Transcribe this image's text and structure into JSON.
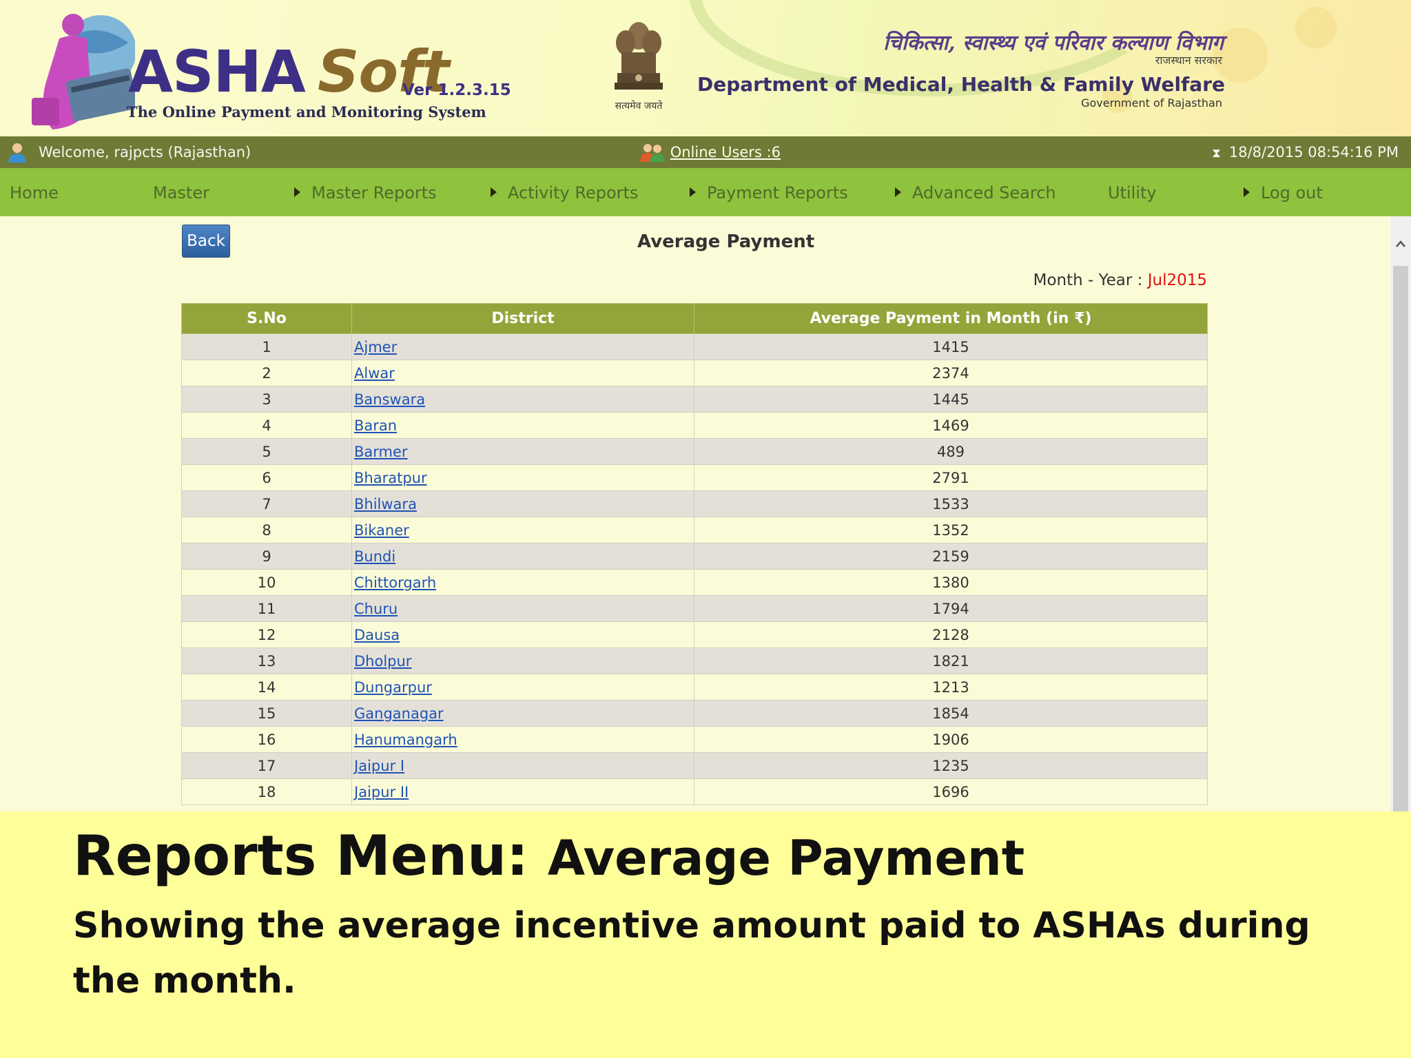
{
  "header": {
    "app_name_part1": "ASHA",
    "app_name_part2": "Soft",
    "version": "Ver 1.2.3.15",
    "tagline": "The Online Payment and Monitoring System",
    "emblem_caption": "सत्यमेव जयते",
    "dept_hindi": "चिकित्सा, स्वास्थ्य एवं परिवार कल्याण विभाग",
    "state_hindi": "राजस्थान सरकार",
    "dept_english": "Department of Medical, Health & Family Welfare",
    "govt_english": "Government of Rajasthan"
  },
  "status_bar": {
    "welcome": "Welcome, rajpcts (Rajasthan)",
    "online_users": "Online Users :6",
    "datetime": "18/8/2015 08:54:16 PM"
  },
  "nav": [
    {
      "label": "Home",
      "has_arrow": false
    },
    {
      "label": "Master",
      "has_arrow": false
    },
    {
      "label": "Master Reports",
      "has_arrow": true
    },
    {
      "label": "Activity Reports",
      "has_arrow": true
    },
    {
      "label": "Payment Reports",
      "has_arrow": true
    },
    {
      "label": "Advanced Search",
      "has_arrow": true
    },
    {
      "label": "Utility",
      "has_arrow": false
    },
    {
      "label": "Log out",
      "has_arrow": true
    }
  ],
  "page": {
    "back_label": "Back",
    "title": "Average Payment",
    "month_year_label": "Month - Year :",
    "month_year_value": "Jul2015"
  },
  "table": {
    "headers": [
      "S.No",
      "District",
      "Average Payment in Month (in ₹)"
    ],
    "rows": [
      {
        "sno": "1",
        "district": "Ajmer",
        "amount": "1415"
      },
      {
        "sno": "2",
        "district": "Alwar",
        "amount": "2374"
      },
      {
        "sno": "3",
        "district": "Banswara",
        "amount": "1445"
      },
      {
        "sno": "4",
        "district": "Baran",
        "amount": "1469"
      },
      {
        "sno": "5",
        "district": "Barmer",
        "amount": "489"
      },
      {
        "sno": "6",
        "district": "Bharatpur",
        "amount": "2791"
      },
      {
        "sno": "7",
        "district": "Bhilwara",
        "amount": "1533"
      },
      {
        "sno": "8",
        "district": "Bikaner",
        "amount": "1352"
      },
      {
        "sno": "9",
        "district": "Bundi",
        "amount": "2159"
      },
      {
        "sno": "10",
        "district": "Chittorgarh",
        "amount": "1380"
      },
      {
        "sno": "11",
        "district": "Churu",
        "amount": "1794"
      },
      {
        "sno": "12",
        "district": "Dausa",
        "amount": "2128"
      },
      {
        "sno": "13",
        "district": "Dholpur",
        "amount": "1821"
      },
      {
        "sno": "14",
        "district": "Dungarpur",
        "amount": "1213"
      },
      {
        "sno": "15",
        "district": "Ganganagar",
        "amount": "1854"
      },
      {
        "sno": "16",
        "district": "Hanumangarh",
        "amount": "1906"
      },
      {
        "sno": "17",
        "district": "Jaipur I",
        "amount": "1235"
      },
      {
        "sno": "18",
        "district": "Jaipur II",
        "amount": "1696"
      }
    ]
  },
  "caption": {
    "title_main": "Reports Menu:",
    "title_sub": "Average Payment",
    "description": "Showing the average incentive amount paid to ASHAs during the month."
  },
  "colors": {
    "welcome_bar": "#6f7a36",
    "nav_bar": "#8fc23d",
    "table_header": "#93a53a",
    "link": "#1e53b5",
    "month_value": "#e01010",
    "caption_bg": "#ffff99"
  }
}
